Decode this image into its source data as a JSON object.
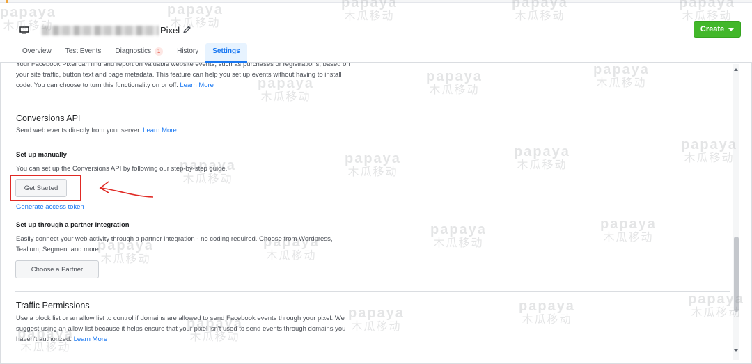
{
  "header": {
    "pixel_name": "Pixel",
    "create_label": "Create"
  },
  "tabs": [
    {
      "label": "Overview"
    },
    {
      "label": "Test Events"
    },
    {
      "label": "Diagnostics",
      "badge": "1"
    },
    {
      "label": "History"
    },
    {
      "label": "Settings",
      "active": true
    }
  ],
  "intro": {
    "line1": "Your Facebook Pixel can find and report on valuable website events, such as purchases or registrations, based on",
    "line2": "your site traffic, button text and page metadata. This feature can help you set up events without having to install",
    "line3": "code. You can choose to turn this functionality on or off.",
    "learn_more": "Learn More"
  },
  "conversions_api": {
    "title": "Conversions API",
    "description": "Send web events directly from your server.",
    "learn_more": "Learn More",
    "manual": {
      "title": "Set up manually",
      "description": "You can set up the Conversions API by following our step-by-step guide.",
      "button": "Get Started",
      "token_link": "Generate access token"
    },
    "partner": {
      "title": "Set up through a partner integration",
      "line1": "Easily connect your web activity through a partner integration - no coding required. Choose from Wordpress,",
      "line2": "Tealium, Segment and more.",
      "button": "Choose a Partner"
    }
  },
  "traffic": {
    "title": "Traffic Permissions",
    "line1": "Use a block list or an allow list to control if domains are allowed to send Facebook events through your pixel. We",
    "line2": "suggest using an allow list because it helps ensure that your pixel isn't used to send events through domains you",
    "line3": "haven't authorized.",
    "learn_more": "Learn More"
  },
  "watermark": {
    "latin": "papaya",
    "cjk": "木瓜移动"
  },
  "colors": {
    "accent": "#1877f2",
    "create_green": "#42b72a",
    "annotation_red": "#e02a25"
  }
}
